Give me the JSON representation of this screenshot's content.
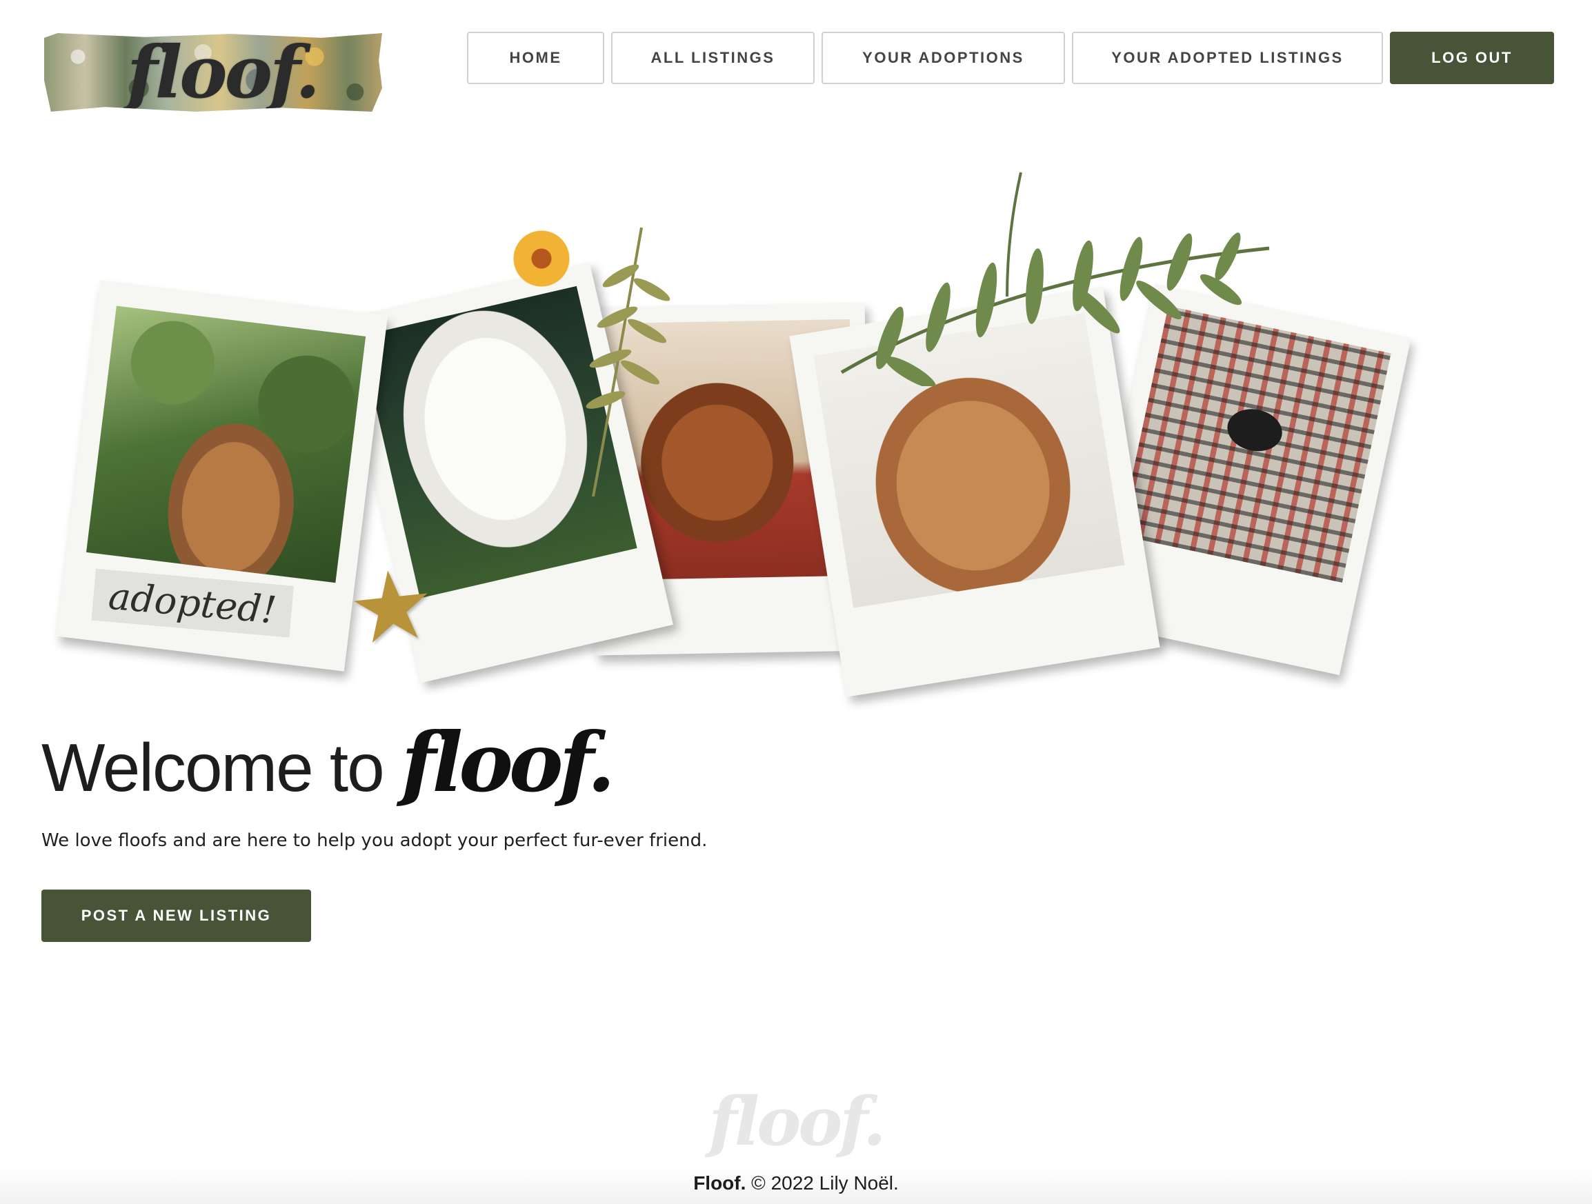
{
  "brand": {
    "logo_text": "floof.",
    "welcome_brand": "floof."
  },
  "nav": {
    "home": "HOME",
    "all_listings": "ALL LISTINGS",
    "your_adoptions": "YOUR ADOPTIONS",
    "your_adopted_listings": "YOUR ADOPTED LISTINGS",
    "log_out": "LOG OUT"
  },
  "hero": {
    "adopted_label": "adopted!"
  },
  "welcome": {
    "heading": "Welcome to",
    "tagline": "We love floofs and are here to help you adopt your perfect fur-ever friend.",
    "cta_label": "POST A NEW LISTING"
  },
  "footer": {
    "logo_text": "floof.",
    "brand": "Floof.",
    "copyright": "© 2022 Lily Noël."
  },
  "colors": {
    "accent": "#475438",
    "nav_border": "#cfcfcf",
    "text": "#1d1d1d"
  },
  "icons": {
    "star": "gold-star-sticker",
    "flower": "yellow-flower",
    "fern": "fern-leaf"
  }
}
